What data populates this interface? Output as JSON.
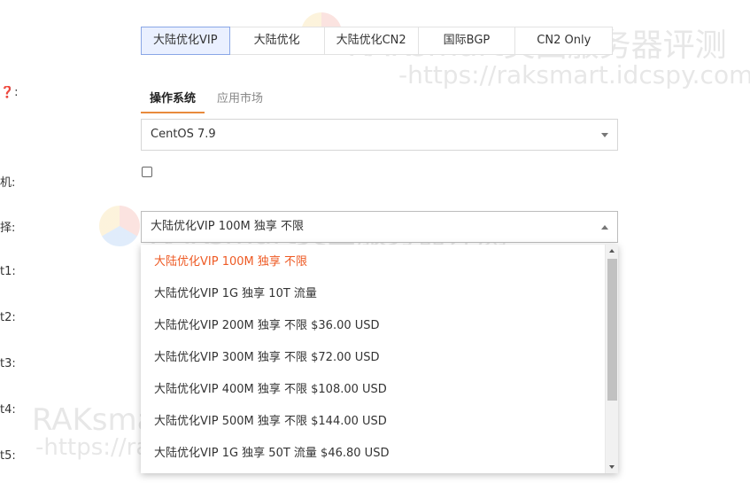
{
  "region_tabs": [
    {
      "label": "大陆优化VIP",
      "active": true
    },
    {
      "label": "大陆优化",
      "active": false
    },
    {
      "label": "大陆优化CN2",
      "active": false
    },
    {
      "label": "国际BGP",
      "active": false
    },
    {
      "label": "CN2 Only",
      "active": false
    }
  ],
  "left_labels": {
    "help": "❓:",
    "label_ji": "机:",
    "label_ze": "择:",
    "label_1": "t1:",
    "label_2": "t2:",
    "label_3": "t3:",
    "label_4": "t4:",
    "label_5": "t5:"
  },
  "os_tabs": [
    {
      "label": "操作系统",
      "active": true
    },
    {
      "label": "应用市场",
      "active": false
    }
  ],
  "os_select": {
    "value": "CentOS 7.9"
  },
  "bandwidth_select": {
    "value": "大陆优化VIP 100M 独享 不限"
  },
  "bandwidth_options": [
    {
      "label": "大陆优化VIP 100M 独享 不限",
      "selected": true
    },
    {
      "label": "大陆优化VIP 1G 独享 10T 流量",
      "selected": false
    },
    {
      "label": "大陆优化VIP 200M 独享 不限 $36.00 USD",
      "selected": false
    },
    {
      "label": "大陆优化VIP 300M 独享 不限 $72.00 USD",
      "selected": false
    },
    {
      "label": "大陆优化VIP 400M 独享 不限 $108.00 USD",
      "selected": false
    },
    {
      "label": "大陆优化VIP 500M 独享 不限 $144.00 USD",
      "selected": false
    },
    {
      "label": "大陆优化VIP 1G 独享 50T 流量 $46.80 USD",
      "selected": false
    }
  ],
  "watermark": {
    "brand": "RAKsmart美国服务器评测",
    "url": "-https://raksmart.idcspy.com/-"
  },
  "colors": {
    "accent": "#e88a3c",
    "selected_option": "#ee5a24",
    "active_tab_bg": "#eaf0ff"
  }
}
